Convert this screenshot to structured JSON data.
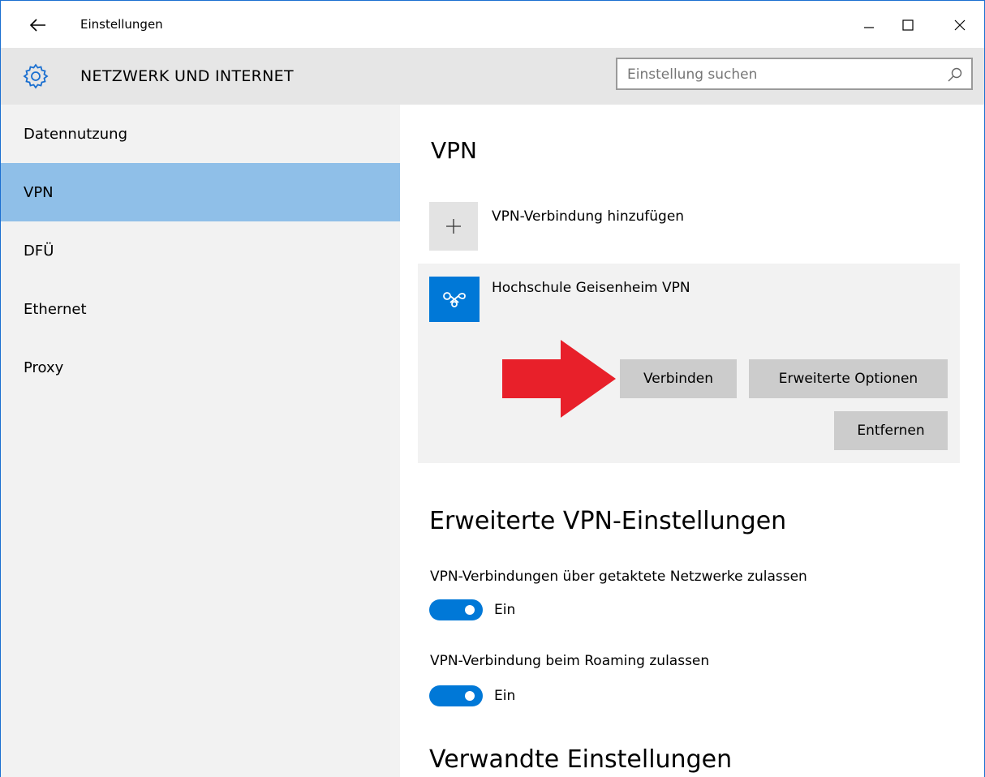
{
  "window": {
    "title": "Einstellungen",
    "controls": {
      "minimize": "—",
      "maximize": "☐",
      "close": "✕"
    }
  },
  "header": {
    "section_title": "NETZWERK UND INTERNET",
    "search_placeholder": "Einstellung suchen",
    "icons": {
      "section": "gear-icon",
      "search": "search-icon",
      "back": "back-arrow-icon"
    }
  },
  "sidebar": {
    "items": [
      {
        "label": "Datennutzung",
        "active": false
      },
      {
        "label": "VPN",
        "active": true
      },
      {
        "label": "DFÜ",
        "active": false
      },
      {
        "label": "Ethernet",
        "active": false
      },
      {
        "label": "Proxy",
        "active": false
      }
    ]
  },
  "main": {
    "heading": "VPN",
    "add_connection_label": "VPN-Verbindung hinzufügen",
    "connection": {
      "name": "Hochschule Geisenheim VPN",
      "buttons": {
        "connect": "Verbinden",
        "advanced": "Erweiterte Optionen",
        "remove": "Entfernen"
      }
    },
    "advanced_heading": "Erweiterte VPN-Einstellungen",
    "options": [
      {
        "label": "VPN-Verbindungen über getaktete Netzwerke zulassen",
        "state": "Ein",
        "on": true
      },
      {
        "label": "VPN-Verbindung beim Roaming zulassen",
        "state": "Ein",
        "on": true
      }
    ],
    "related_heading": "Verwandte Einstellungen"
  },
  "colors": {
    "accent": "#0078d7",
    "active_nav": "#8fbfe8",
    "annotation_arrow": "#e8202a"
  }
}
